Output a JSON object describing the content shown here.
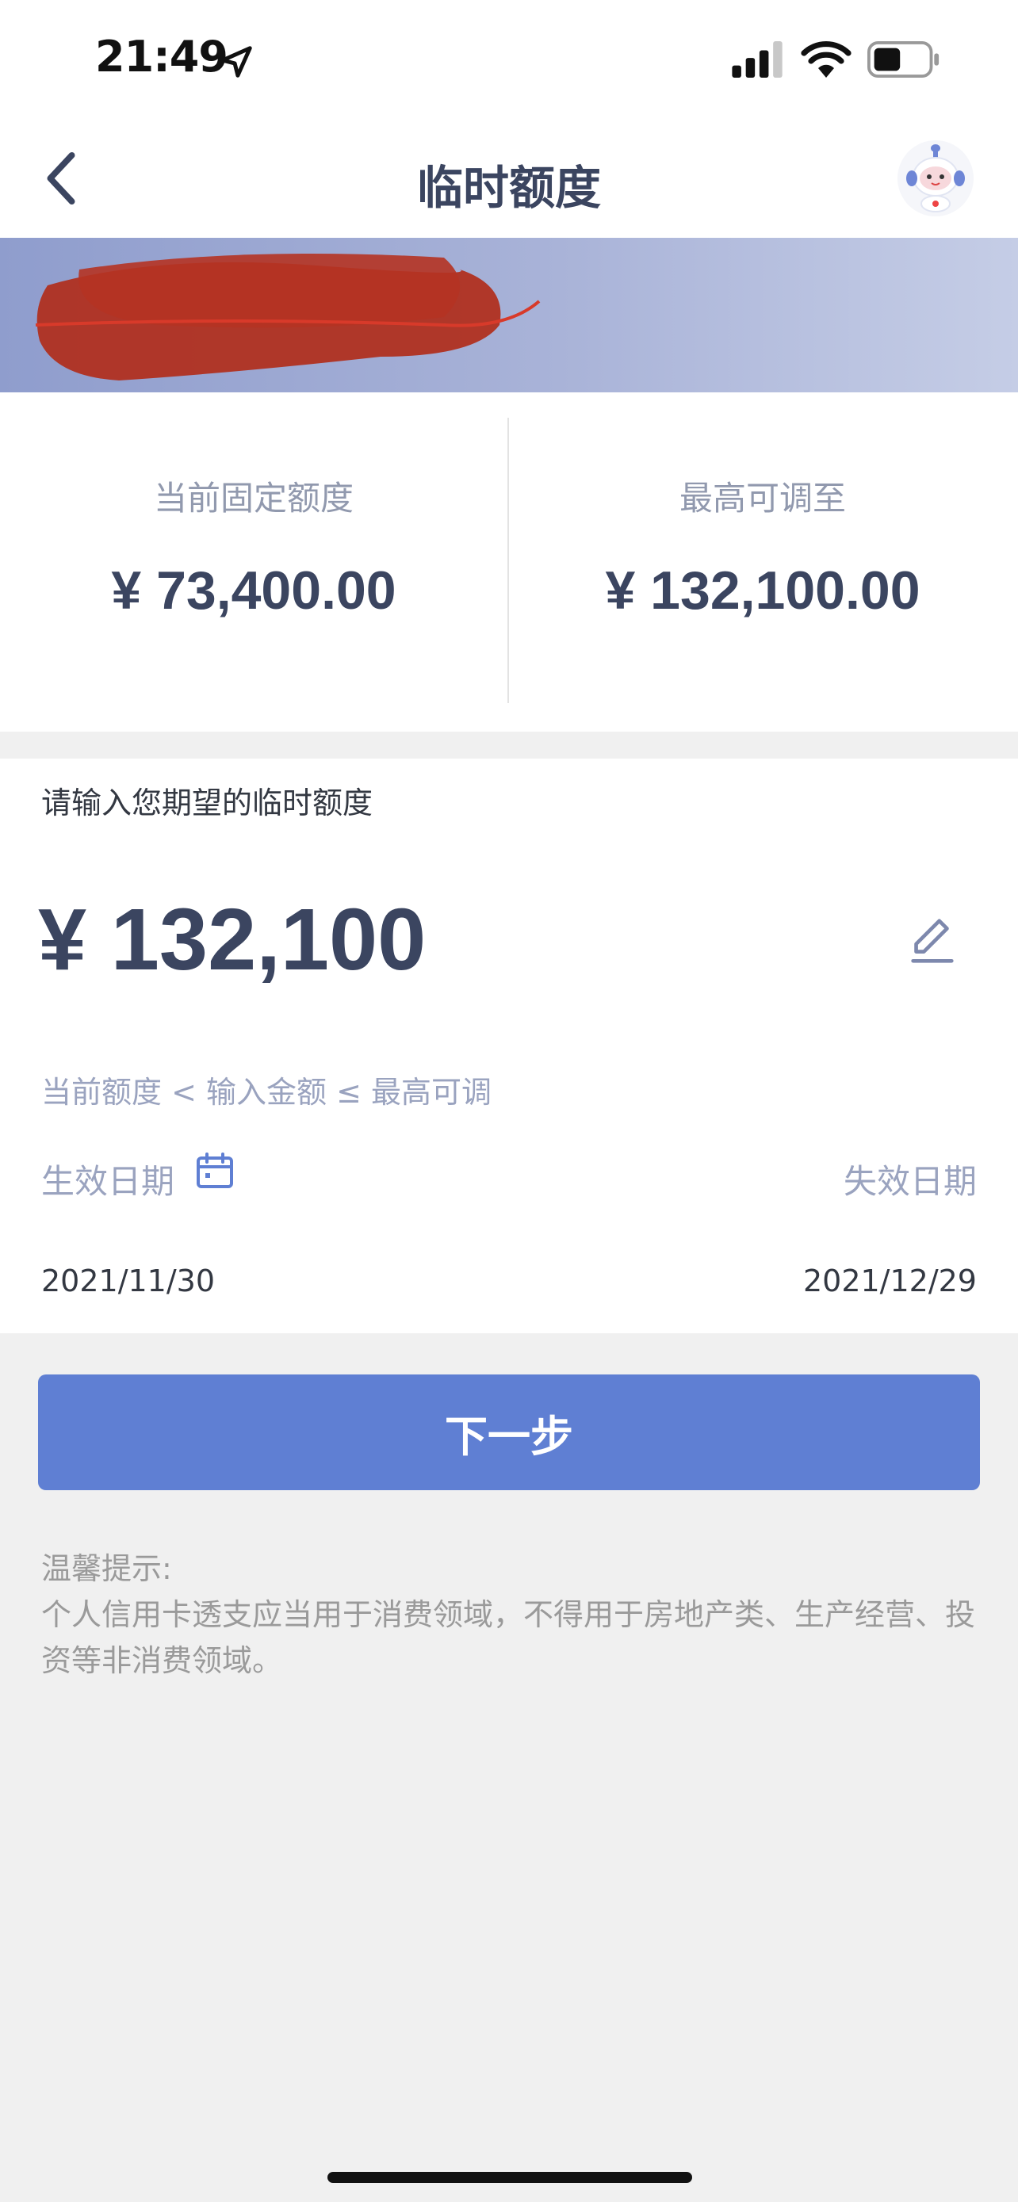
{
  "status_bar": {
    "time": "21:49"
  },
  "nav": {
    "title": "临时额度"
  },
  "quota": {
    "current_label": "当前固定额度",
    "current_value": "¥ 73,400.00",
    "max_label": "最高可调至",
    "max_value": "¥ 132,100.00"
  },
  "input": {
    "prompt": "请输入您期望的临时额度",
    "amount": "¥ 132,100",
    "range_hint": "当前额度 < 输入金额 ≤ 最高可调",
    "effective_label": "生效日期",
    "expiry_label": "失效日期",
    "effective_date": "2021/11/30",
    "expiry_date": "2021/12/29"
  },
  "actions": {
    "next_label": "下一步"
  },
  "tips": {
    "title": "温馨提示:",
    "body": "个人信用卡透支应当用于消费领域，不得用于房地产类、生产经营、投资等非消费领域。"
  },
  "colors": {
    "primary": "#5f7fd3",
    "text_dark": "#3b4560",
    "text_muted": "#9aa3bf",
    "background": "#f0f0f0"
  },
  "icons": [
    "location-arrow-icon",
    "signal-icon",
    "wifi-icon",
    "battery-icon",
    "back-chevron-icon",
    "assistant-robot-icon",
    "edit-pencil-icon",
    "calendar-icon"
  ]
}
